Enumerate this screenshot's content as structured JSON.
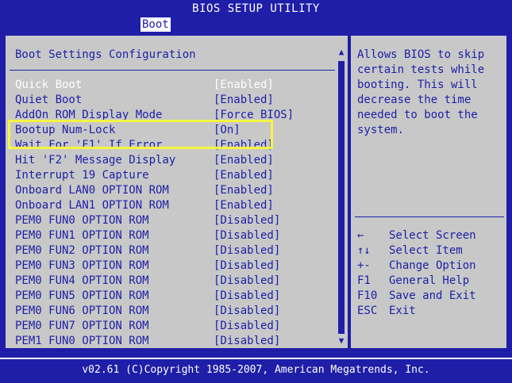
{
  "title": "BIOS SETUP UTILITY",
  "menu": {
    "active_tab": "Boot"
  },
  "main": {
    "section_title": "Boot Settings Configuration",
    "items": [
      {
        "label": "Quick Boot",
        "value": "[Enabled]",
        "selected": true
      },
      {
        "label": "Quiet Boot",
        "value": "[Enabled]"
      },
      {
        "label": "AddOn ROM Display Mode",
        "value": "[Force BIOS]"
      },
      {
        "label": "Bootup Num-Lock",
        "value": "[On]"
      },
      {
        "label": "Wait For 'F1' If Error",
        "value": "[Enabled]"
      },
      {
        "label": "Hit 'F2' Message Display",
        "value": "[Enabled]"
      },
      {
        "label": "Interrupt 19 Capture",
        "value": "[Enabled]"
      },
      {
        "label": "Onboard LAN0 OPTION ROM",
        "value": "[Enabled]"
      },
      {
        "label": "Onboard LAN1 OPTION ROM",
        "value": "[Enabled]"
      },
      {
        "label": "PEM0 FUN0 OPTION ROM",
        "value": "[Disabled]"
      },
      {
        "label": "PEM0 FUN1 OPTION ROM",
        "value": "[Disabled]"
      },
      {
        "label": "PEM0 FUN2 OPTION ROM",
        "value": "[Disabled]"
      },
      {
        "label": "PEM0 FUN3 OPTION ROM",
        "value": "[Disabled]"
      },
      {
        "label": "PEM0 FUN4 OPTION ROM",
        "value": "[Disabled]"
      },
      {
        "label": "PEM0 FUN5 OPTION ROM",
        "value": "[Disabled]"
      },
      {
        "label": "PEM0 FUN6 OPTION ROM",
        "value": "[Disabled]"
      },
      {
        "label": "PEM0 FUN7 OPTION ROM",
        "value": "[Disabled]"
      },
      {
        "label": "PEM1 FUN0 OPTION ROM",
        "value": "[Disabled]"
      }
    ]
  },
  "help": {
    "text": "Allows BIOS to skip\ncertain tests while\nbooting. This will\ndecrease the time\nneeded to boot the\nsystem.",
    "keys": [
      {
        "key": "←",
        "desc": "Select Screen"
      },
      {
        "key": "↑↓",
        "desc": "Select Item"
      },
      {
        "key": "+-",
        "desc": "Change Option"
      },
      {
        "key": "F1",
        "desc": "General Help"
      },
      {
        "key": "F10",
        "desc": "Save and Exit"
      },
      {
        "key": "ESC",
        "desc": "Exit"
      }
    ]
  },
  "scrollbar": {
    "up_icon": "▲",
    "down_icon": "▼"
  },
  "footer": "v02.61 (C)Copyright 1985-2007, American Megatrends, Inc.",
  "colors": {
    "background": "#1e1ea8",
    "panel": "#c8c8c8",
    "text": "#1e1ea8",
    "highlight": "#f5f543"
  }
}
